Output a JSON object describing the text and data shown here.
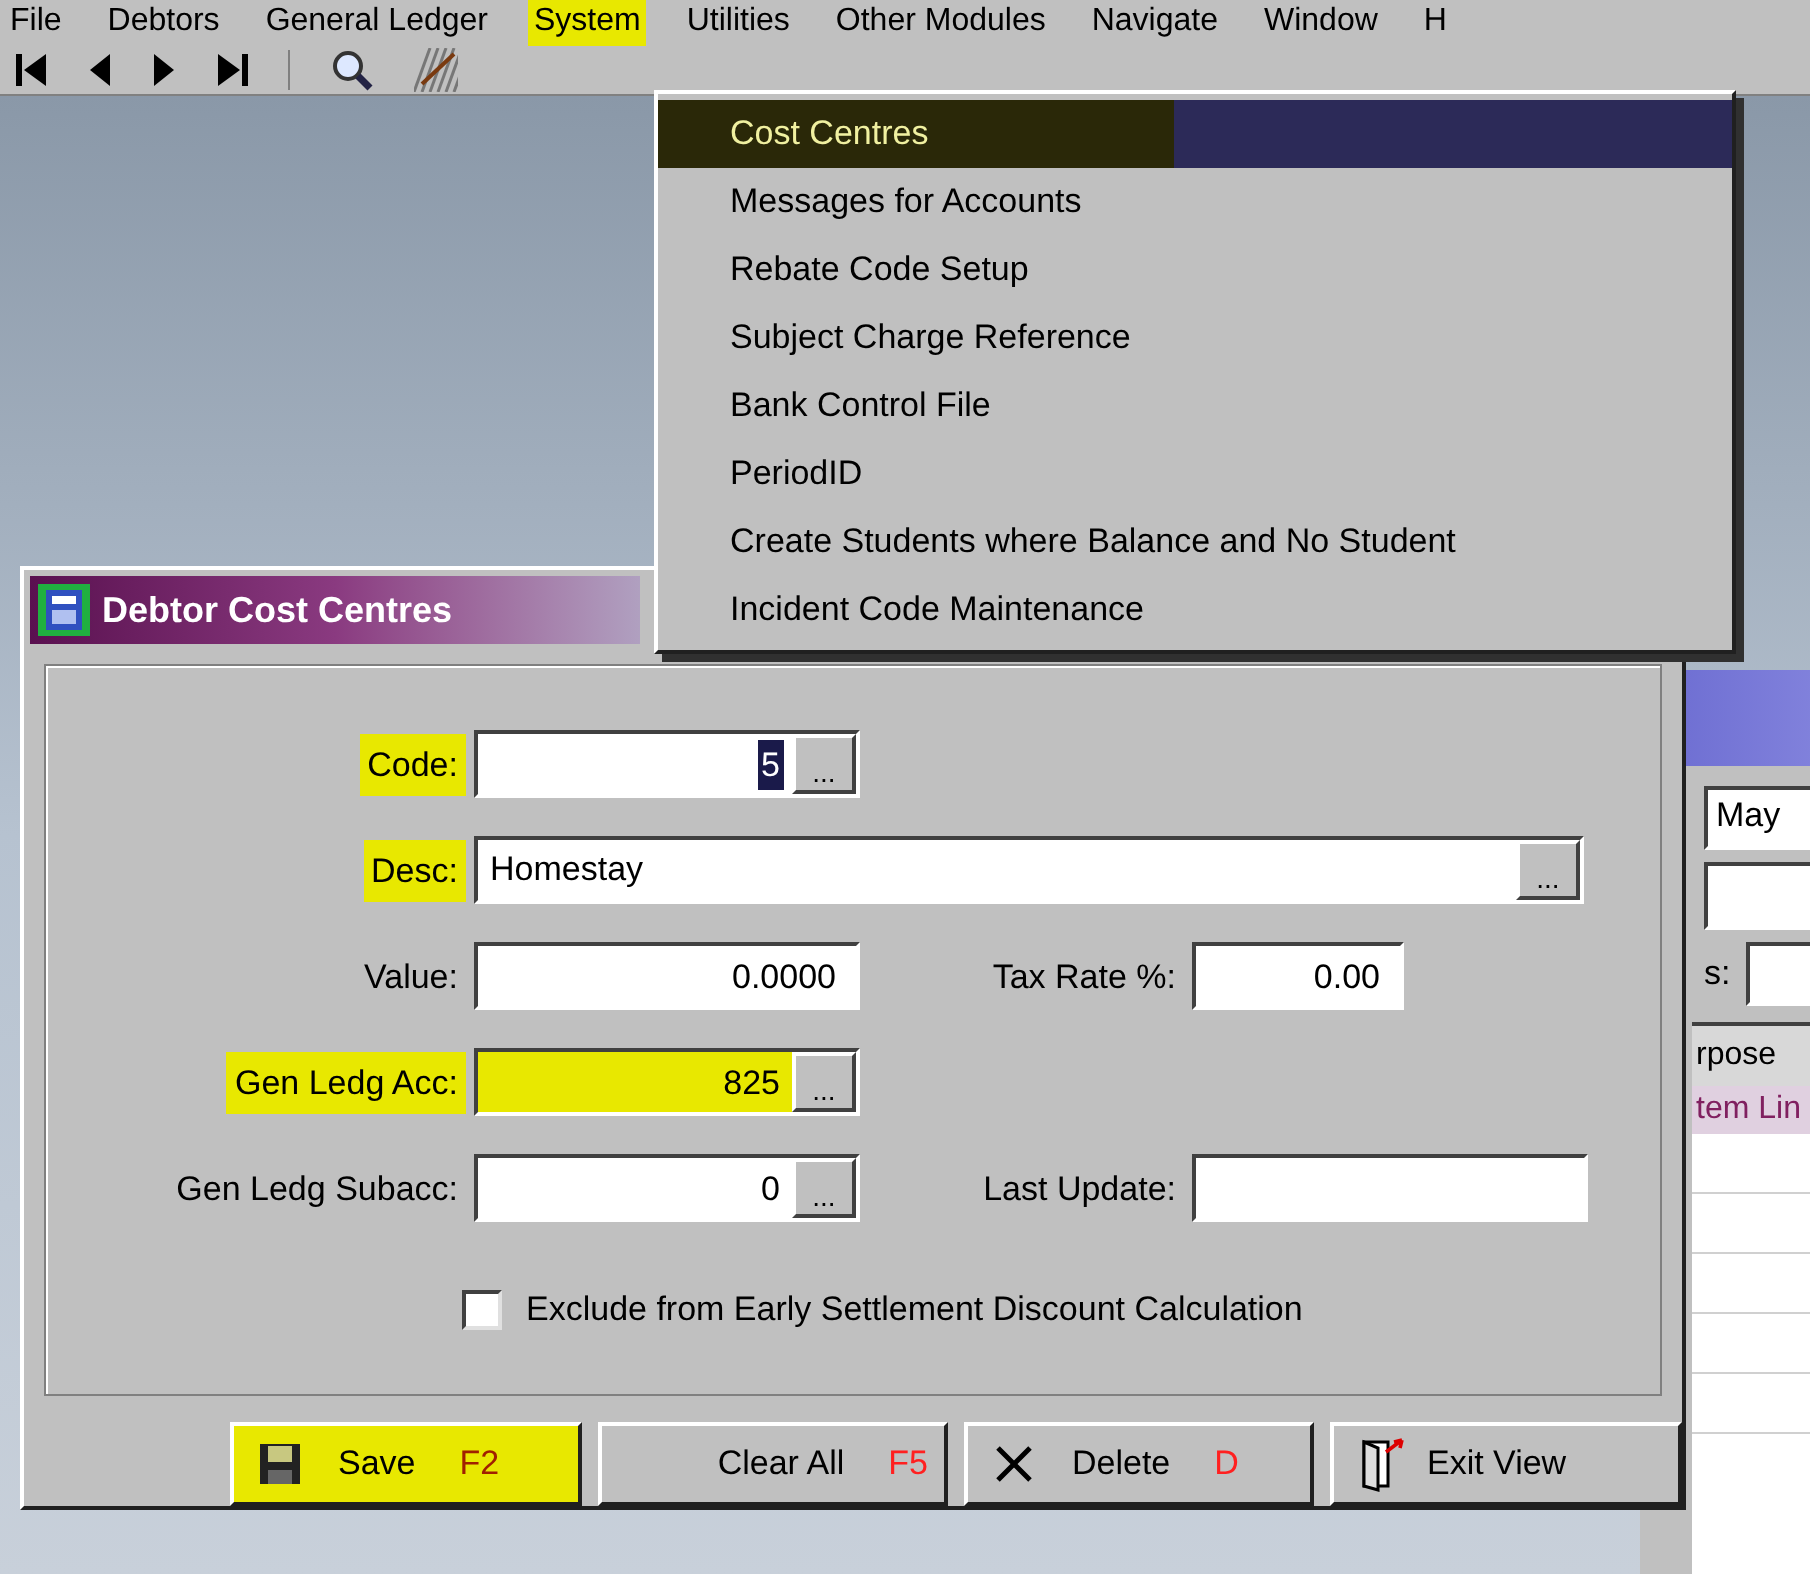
{
  "menu_bar": [
    {
      "label": "File",
      "highlighted": false
    },
    {
      "label": "Debtors",
      "highlighted": false
    },
    {
      "label": "General Ledger",
      "highlighted": false
    },
    {
      "label": "System",
      "highlighted": true
    },
    {
      "label": "Utilities",
      "highlighted": false
    },
    {
      "label": "Other Modules",
      "highlighted": false
    },
    {
      "label": "Navigate",
      "highlighted": false
    },
    {
      "label": "Window",
      "highlighted": false
    },
    {
      "label": "H",
      "highlighted": false
    }
  ],
  "system_menu": [
    {
      "label": "Cost Centres",
      "selected": true,
      "highlighted": true
    },
    {
      "label": "Messages for Accounts",
      "selected": false,
      "highlighted": false
    },
    {
      "label": "Rebate Code Setup",
      "selected": false,
      "highlighted": false
    },
    {
      "label": "Subject Charge Reference",
      "selected": false,
      "highlighted": false
    },
    {
      "label": "Bank Control File",
      "selected": false,
      "highlighted": false
    },
    {
      "label": "PeriodID",
      "selected": false,
      "highlighted": false
    },
    {
      "label": "Create Students where Balance and No Student",
      "selected": false,
      "highlighted": false
    },
    {
      "label": "Incident Code Maintenance",
      "selected": false,
      "highlighted": false
    }
  ],
  "background_window": {
    "date_field": "May",
    "label": "s:",
    "text_1": "rpose",
    "text_2": "tem Lin"
  },
  "dialog": {
    "title": "Debtor Cost Centres",
    "rows": [
      [
        {
          "label": "Code:",
          "value": "5",
          "kind": "lookup",
          "lookup_button": "...",
          "label_highlighted": true,
          "value_highlighted": false,
          "value_selected": true
        }
      ],
      [
        {
          "label": "Desc:",
          "value": "Homestay",
          "kind": "wide",
          "lookup_button": "...",
          "label_highlighted": true,
          "value_highlighted": false
        }
      ],
      [
        {
          "label": "Value:",
          "value": "0.0000",
          "kind": "plain",
          "label_highlighted": false,
          "value_highlighted": false
        },
        {
          "label": "Tax Rate %:",
          "value": "0.00",
          "kind": "small",
          "label_highlighted": false,
          "value_highlighted": false
        }
      ],
      [
        {
          "label": "Gen Ledg Acc:",
          "value": "825",
          "kind": "lookup",
          "lookup_button": "...",
          "label_highlighted": true,
          "value_highlighted": true
        }
      ],
      [
        {
          "label": "Gen Ledg Subacc:",
          "value": "0",
          "kind": "lookup",
          "lookup_button": "...",
          "label_highlighted": false,
          "value_highlighted": false
        },
        {
          "label": "Last Update:",
          "kind": "date",
          "label_highlighted": false,
          "value_highlighted": false
        }
      ]
    ],
    "checkbox": {
      "label": "Exclude from Early Settlement Discount Calculation",
      "checked": false
    },
    "buttons": [
      {
        "kind": "save",
        "label": "Save",
        "key": "F2",
        "highlighted": true
      },
      {
        "kind": "clear",
        "label": "Clear All",
        "key": "F5",
        "highlighted": false
      },
      {
        "kind": "delete",
        "label": "Delete",
        "key": "D",
        "highlighted": false
      },
      {
        "kind": "exit",
        "label": "Exit View",
        "highlighted": false
      }
    ]
  }
}
